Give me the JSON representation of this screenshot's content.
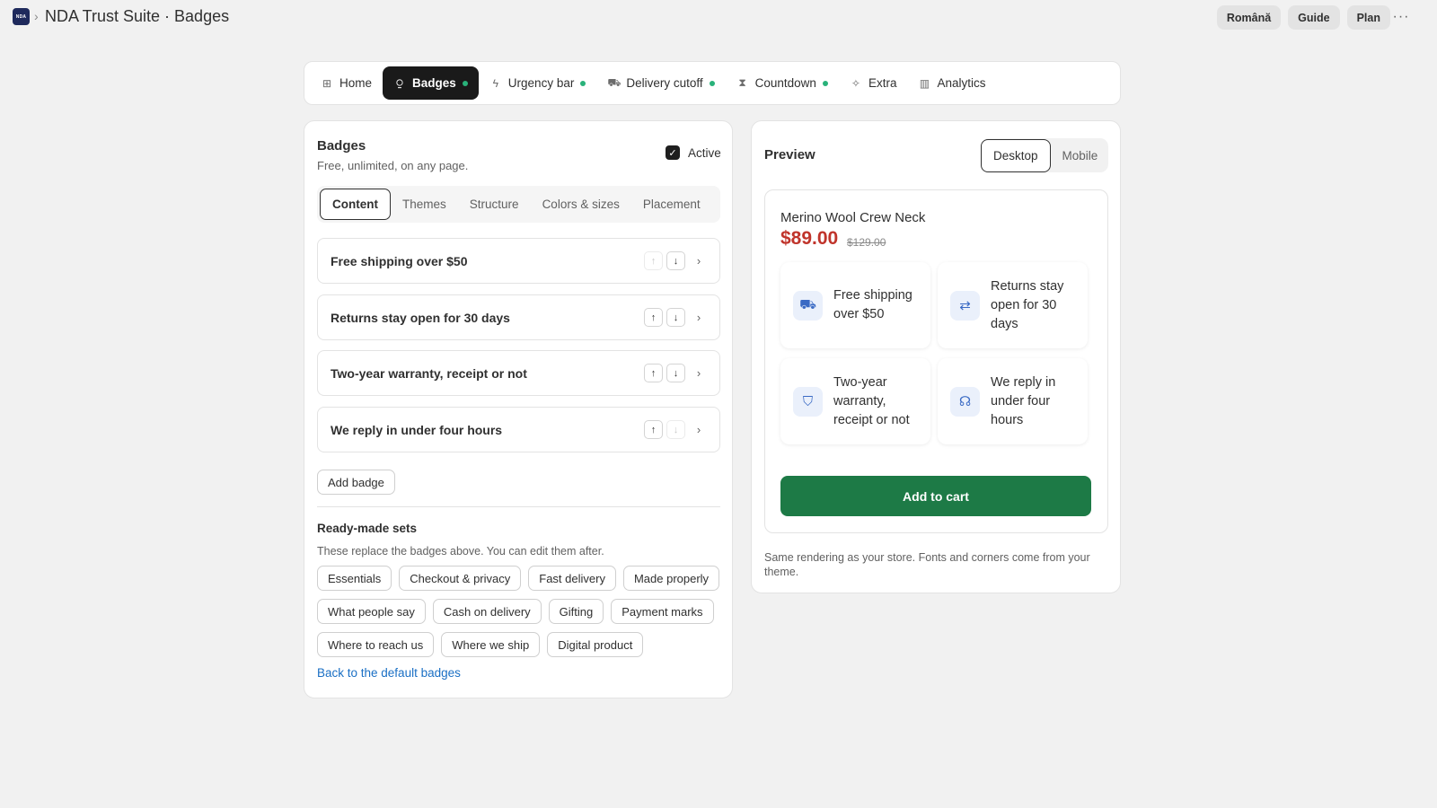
{
  "header": {
    "logo_text": "NDA",
    "title": "NDA Trust Suite · Badges",
    "actions": [
      "Română",
      "Guide",
      "Plan"
    ],
    "more": "···"
  },
  "nav": {
    "tabs": [
      {
        "label": "Home",
        "icon": "home-icon",
        "glyph": "⊞",
        "dot": false,
        "active": false
      },
      {
        "label": "Badges",
        "icon": "badge-icon",
        "glyph": "⍜",
        "dot": true,
        "active": true
      },
      {
        "label": "Urgency bar",
        "icon": "lightning-icon",
        "glyph": "ϟ",
        "dot": true,
        "active": false
      },
      {
        "label": "Delivery cutoff",
        "icon": "truck-icon",
        "glyph": "⛟",
        "dot": true,
        "active": false
      },
      {
        "label": "Countdown",
        "icon": "hourglass-icon",
        "glyph": "⧗",
        "dot": true,
        "active": false
      },
      {
        "label": "Extra",
        "icon": "sparkle-icon",
        "glyph": "✧",
        "dot": false,
        "active": false
      },
      {
        "label": "Analytics",
        "icon": "bar-chart-icon",
        "glyph": "▥",
        "dot": false,
        "active": false
      }
    ],
    "status_color": "#29b27a"
  },
  "badges_panel": {
    "title": "Badges",
    "subtitle": "Free, unlimited, on any page.",
    "active_label": "Active",
    "active_checked": true,
    "subtabs": [
      "Content",
      "Themes",
      "Structure",
      "Colors & sizes",
      "Placement"
    ],
    "active_subtab": "Content",
    "badges": [
      {
        "label": "Free shipping over $50",
        "up_disabled": true,
        "down_disabled": false
      },
      {
        "label": "Returns stay open for 30 days",
        "up_disabled": false,
        "down_disabled": false
      },
      {
        "label": "Two-year warranty, receipt or not",
        "up_disabled": false,
        "down_disabled": false
      },
      {
        "label": "We reply in under four hours",
        "up_disabled": false,
        "down_disabled": true
      }
    ],
    "add_badge_label": "Add badge",
    "sets_title": "Ready-made sets",
    "sets_subtitle": "These replace the badges above. You can edit them after.",
    "sets": [
      "Essentials",
      "Checkout & privacy",
      "Fast delivery",
      "Made properly",
      "What people say",
      "Cash on delivery",
      "Gifting",
      "Payment marks",
      "Where to reach us",
      "Where we ship",
      "Digital product"
    ],
    "back_link": "Back to the default badges"
  },
  "preview": {
    "title": "Preview",
    "devices": [
      "Desktop",
      "Mobile"
    ],
    "active_device": "Desktop",
    "product_name": "Merino Wool Crew Neck",
    "price": "$89.00",
    "old_price": "$129.00",
    "price_color": "#c0342b",
    "tiles": [
      {
        "text": "Free shipping over $50",
        "icon": "truck-icon",
        "glyph": "⛟"
      },
      {
        "text": "Returns stay open for 30 days",
        "icon": "swap-arrows-icon",
        "glyph": "⇄"
      },
      {
        "text": "Two-year warranty, receipt or not",
        "icon": "shield-check-icon",
        "glyph": "⛉"
      },
      {
        "text": "We reply in under four hours",
        "icon": "headset-icon",
        "glyph": "☊"
      }
    ],
    "cart_label": "Add to cart",
    "cart_color": "#1d7a46",
    "note": "Same rendering as your store. Fonts and corners come from your theme."
  }
}
